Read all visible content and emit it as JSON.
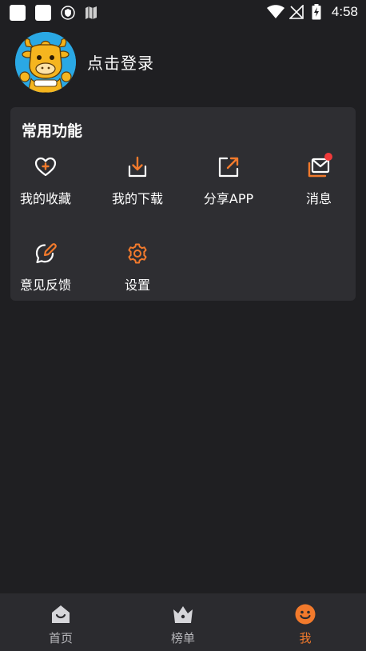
{
  "status_bar": {
    "time": "4:58"
  },
  "profile": {
    "login_label": "点击登录"
  },
  "common_functions": {
    "title": "常用功能",
    "items": [
      {
        "label": "我的收藏",
        "icon": "heart-plus-icon"
      },
      {
        "label": "我的下载",
        "icon": "download-icon"
      },
      {
        "label": "分享APP",
        "icon": "share-icon"
      },
      {
        "label": "消息",
        "icon": "mail-icon",
        "has_badge": true
      },
      {
        "label": "意见反馈",
        "icon": "feedback-icon"
      },
      {
        "label": "设置",
        "icon": "settings-gear-icon"
      }
    ]
  },
  "bottom_nav": {
    "tabs": [
      {
        "label": "首页",
        "icon": "home-icon",
        "active": false
      },
      {
        "label": "榜单",
        "icon": "crown-icon",
        "active": false
      },
      {
        "label": "我",
        "icon": "smiley-icon",
        "active": true
      }
    ]
  },
  "colors": {
    "background": "#1f1f22",
    "card": "#2e2e32",
    "accent": "#f27a2c",
    "badge": "#f03a3a",
    "nav_bar": "#2b2b2f"
  }
}
